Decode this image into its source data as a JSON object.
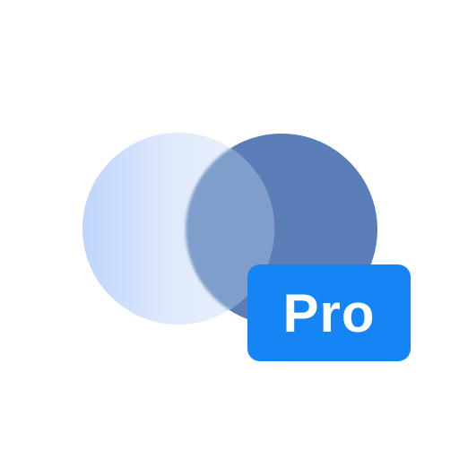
{
  "icon": {
    "name": "overlapping-circles-icon",
    "colors": {
      "back_circle": "#5a7fb8",
      "front_circle_light": "#c3d9ff",
      "front_circle_pale": "#ecf2fb",
      "overlap": "#809fcb",
      "badge": "#1584f5",
      "badge_text": "#ffffff"
    }
  },
  "badge": {
    "label": "Pro"
  }
}
